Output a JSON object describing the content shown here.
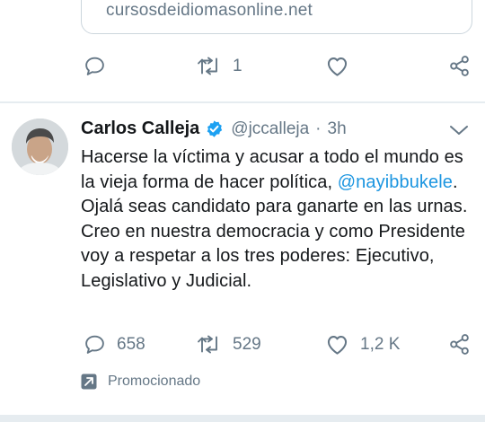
{
  "previous_tweet": {
    "link_card_url": "cursosdeidiomasonline.net",
    "actions": {
      "reply_count": "",
      "retweet_count": "1",
      "like_count": ""
    }
  },
  "tweet": {
    "author_name": "Carlos Calleja",
    "author_handle": "@jccalleja",
    "separator": "·",
    "timestamp": "3h",
    "body_before_mention": "Hacerse la víctima y acusar a todo el mundo es la vieja forma de hacer política, ",
    "mention": "@nayibbukele",
    "body_after_mention": ". Ojalá seas candidato para ganarte en las urnas. Creo en nuestra democracia y como Presidente voy a respetar a los tres poderes: Ejecutivo, Legislativo y Judicial.",
    "actions": {
      "reply_count": "658",
      "retweet_count": "529",
      "like_count": "1,2 K"
    },
    "promoted_label": "Promocionado"
  },
  "icons": {
    "reply": "reply-icon",
    "retweet": "retweet-icon",
    "like": "heart-icon",
    "share": "share-icon",
    "verified": "verified-badge-icon",
    "caret": "chevron-down-icon",
    "promoted": "promoted-arrow-icon"
  },
  "colors": {
    "text_primary": "#14171a",
    "text_secondary": "#657786",
    "link_blue": "#1b95e0",
    "verified_blue": "#1da1f2",
    "divider": "#e6ecf0"
  }
}
